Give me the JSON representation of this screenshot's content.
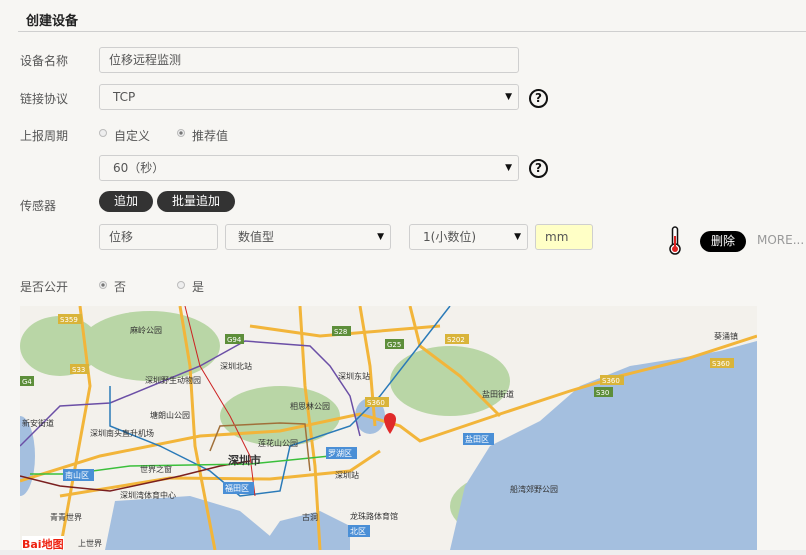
{
  "title": "创建设备",
  "form": {
    "name_label": "设备名称",
    "name_value": "位移远程监测",
    "protocol_label": "链接协议",
    "protocol_value": "TCP",
    "period_label": "上报周期",
    "period_options": [
      "自定义",
      "推荐值"
    ],
    "period_selected": "推荐值",
    "period_value": "60（秒）",
    "sensor_label": "传感器",
    "add_label": "追加",
    "batch_add_label": "批量追加",
    "sensor": {
      "name": "位移",
      "type": "数值型",
      "decimals": "1(小数位)",
      "unit": "mm",
      "delete_label": "删除",
      "more_label": "MORE..."
    },
    "public_label": "是否公开",
    "public_options": [
      "否",
      "是"
    ],
    "public_selected": "否",
    "help_glyph": "?"
  },
  "map": {
    "logo": "Bai地图",
    "labels": [
      "麻岭公园",
      "深圳北站",
      "深圳东站",
      "深圳野生动物园",
      "相思林公园",
      "塘朗山公园",
      "新安街道",
      "深圳南头直升机场",
      "莲花山公园",
      "罗湖区",
      "深圳市",
      "南山区",
      "世界之窗",
      "福田区",
      "深圳站",
      "深圳湾体育中心",
      "盐田区",
      "盐田街道",
      "葵涌镇",
      "船湾郊野公园",
      "古洞",
      "龙珠路体育馆",
      "北区",
      "青青世界",
      "上世界"
    ],
    "road_shields": [
      "S359",
      "G94",
      "S28",
      "G25",
      "S202",
      "S33",
      "G4",
      "S360",
      "S30",
      "S360",
      "S360"
    ],
    "colors": {
      "water": "#a4bfdf",
      "park": "#b9d6a6",
      "road": "#f2b53a",
      "marker": "#e02a2a"
    }
  }
}
